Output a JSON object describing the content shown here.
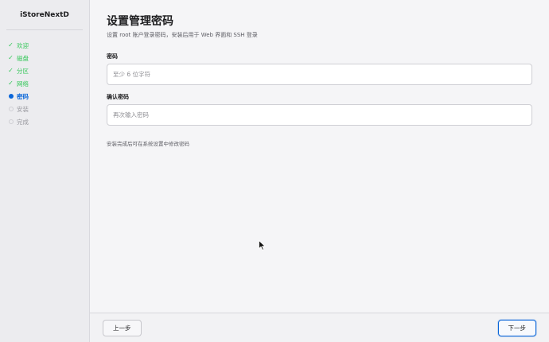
{
  "sidebar": {
    "brand": "iStoreNextD",
    "steps": [
      {
        "label": "欢迎",
        "state": "done"
      },
      {
        "label": "磁盘",
        "state": "done"
      },
      {
        "label": "分区",
        "state": "done"
      },
      {
        "label": "网络",
        "state": "done"
      },
      {
        "label": "密码",
        "state": "active"
      },
      {
        "label": "安装",
        "state": "pending"
      },
      {
        "label": "完成",
        "state": "pending"
      }
    ],
    "done_glyph": "✓"
  },
  "main": {
    "title": "设置管理密码",
    "subtitle": "设置 root 账户登录密码，安装后用于 Web 界面和 SSH 登录",
    "password": {
      "label": "密码",
      "value": "",
      "placeholder": "至少 6 位字符"
    },
    "confirm": {
      "label": "确认密码",
      "value": "",
      "placeholder": "再次输入密码"
    },
    "hint": "安装完成后可在系统设置中修改密码"
  },
  "footer": {
    "back_label": "上一步",
    "next_label": "下一步"
  },
  "colors": {
    "accent": "#0a66d9",
    "done": "#34c759",
    "pending": "#9a9aa0"
  }
}
